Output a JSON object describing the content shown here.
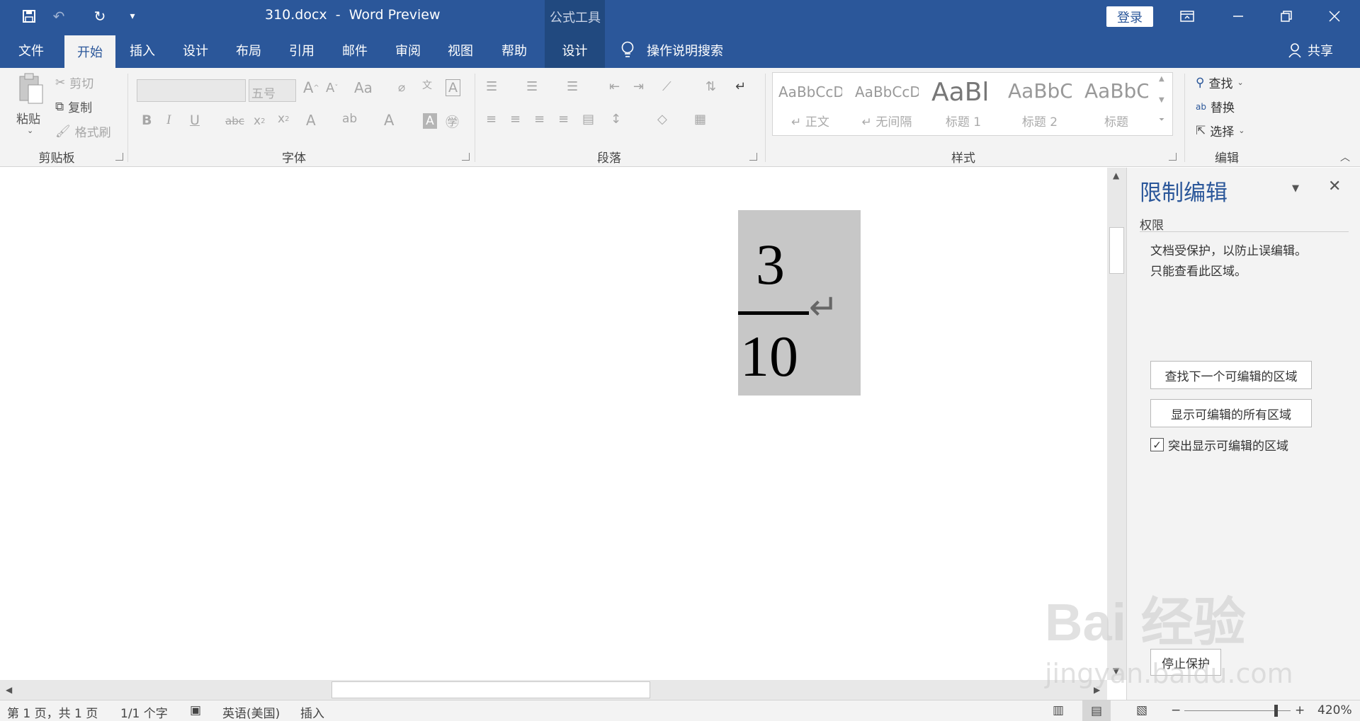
{
  "titlebar": {
    "document_title": "310.docx  -  Word Preview",
    "context_group": "公式工具",
    "login_label": "登录",
    "qat": [
      "save-icon",
      "undo-icon",
      "redo-icon",
      "customize-icon"
    ]
  },
  "tabs": [
    {
      "label": "文件"
    },
    {
      "label": "开始"
    },
    {
      "label": "插入"
    },
    {
      "label": "设计"
    },
    {
      "label": "布局"
    },
    {
      "label": "引用"
    },
    {
      "label": "邮件"
    },
    {
      "label": "审阅"
    },
    {
      "label": "视图"
    },
    {
      "label": "帮助"
    },
    {
      "label": "设计"
    }
  ],
  "tell_me": "操作说明搜索",
  "share_label": "共享",
  "ribbon": {
    "clipboard": {
      "label": "剪贴板",
      "paste": "粘贴",
      "cut": "剪切",
      "copy": "复制",
      "format_painter": "格式刷"
    },
    "font": {
      "label": "字体",
      "font_name": "",
      "font_size": "五号",
      "change_case": "Aa"
    },
    "paragraph": {
      "label": "段落"
    },
    "styles": {
      "label": "样式",
      "items": [
        {
          "preview": "AaBbCcDc",
          "name": "↵ 正文"
        },
        {
          "preview": "AaBbCcDc",
          "name": "↵ 无间隔"
        },
        {
          "preview": "AaBl",
          "name": "标题 1"
        },
        {
          "preview": "AaBbC",
          "name": "标题 2"
        },
        {
          "preview": "AaBbC",
          "name": "标题"
        }
      ]
    },
    "editing": {
      "label": "编辑",
      "find": "查找",
      "replace": "替换",
      "select": "选择"
    }
  },
  "document": {
    "equation": {
      "numerator": "3",
      "denominator": "10"
    },
    "paragraph_mark": "↵"
  },
  "taskpane": {
    "title": "限制编辑",
    "section": "权限",
    "message_line1": "文档受保护，以防止误编辑。",
    "message_line2": "只能查看此区域。",
    "find_next_button": "查找下一个可编辑的区域",
    "show_all_button": "显示可编辑的所有区域",
    "highlight_label": "突出显示可编辑的区域",
    "highlight_checked": true,
    "stop_protection_button": "停止保护"
  },
  "status": {
    "page": "第 1 页，共 1 页",
    "words": "1/1 个字",
    "language": "英语(美国)",
    "mode": "插入",
    "zoom": "420%"
  },
  "watermark": {
    "text": "Bai 经验",
    "sub": "jingyan.baidu.com"
  }
}
